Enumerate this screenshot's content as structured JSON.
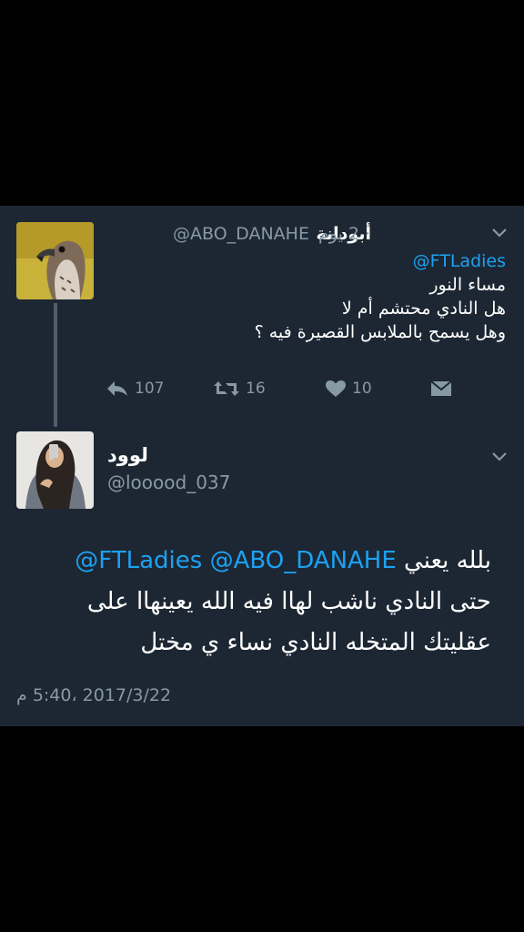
{
  "parent_tweet": {
    "display_name": "أبودانة",
    "handle": "@ABO_DANAHE",
    "separator": "·",
    "time_ago": "2 يوم",
    "mention": "@FTLadies",
    "lines": [
      "مساء النور",
      "هل النادي محتشم أم لا",
      "وهل يسمح بالملابس القصيرة فيه ؟"
    ],
    "replies": "107",
    "retweets": "16",
    "likes": "10"
  },
  "reply_tweet": {
    "display_name": "لوود",
    "handle": "@looood_037",
    "text_line1_prefix": "بلله يعني",
    "mentions": "@FTLadies @ABO_DANAHE",
    "text_line2": "حتى النادي ناشب لهاا فيه الله يعينهاا على",
    "text_line3": "عقليتك المتخله النادي نساء ي مختل",
    "timestamp": "2017/3/22 ،5:40 م"
  },
  "colors": {
    "background": "#1c2733",
    "accent": "#1da1f2",
    "muted": "#8899a6"
  },
  "icons": [
    "reply-icon",
    "retweet-icon",
    "like-icon",
    "dm-icon",
    "chevron-down-icon"
  ]
}
